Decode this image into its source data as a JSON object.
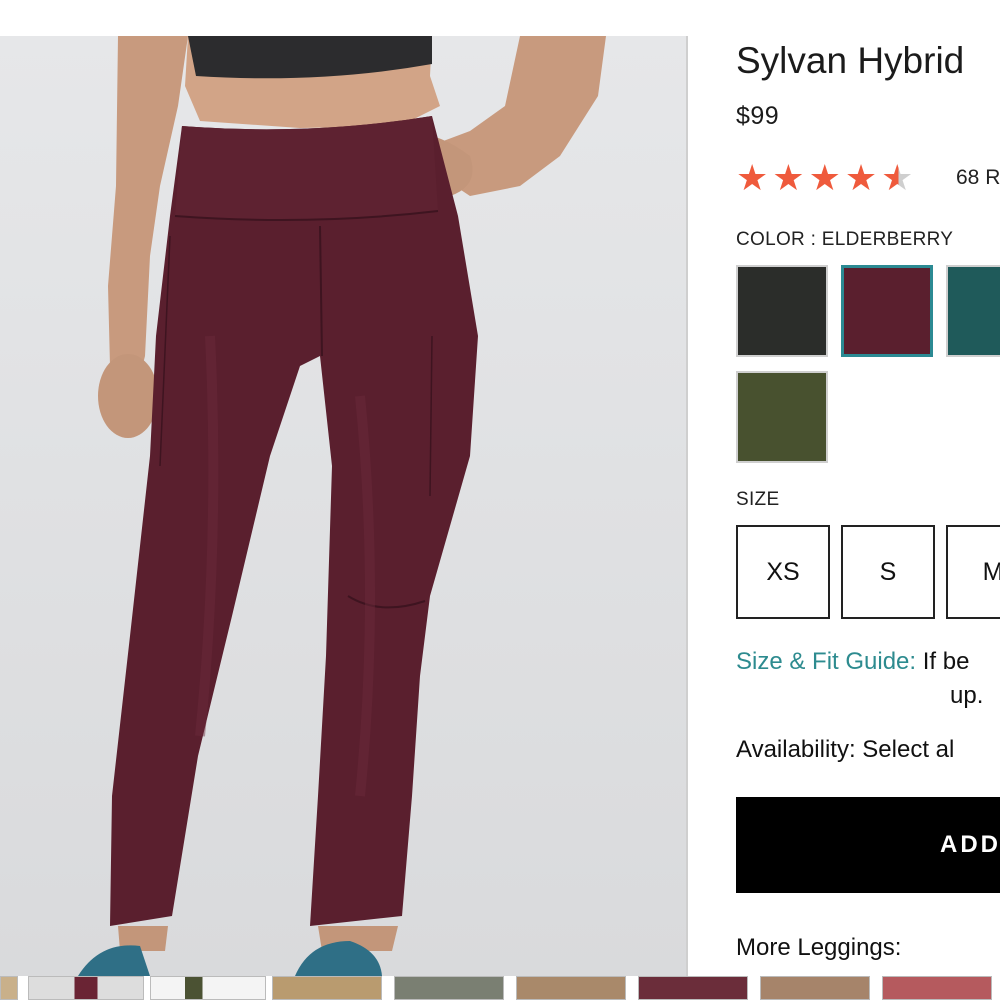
{
  "product": {
    "title": "Sylvan Hybrid",
    "price": "$99",
    "rating": {
      "value": 4.5,
      "max": 5,
      "count_label": "68 R"
    }
  },
  "color": {
    "label": "COLOR : ELDERBERRY",
    "swatches": [
      {
        "color": "#2b2d2a",
        "selected": false
      },
      {
        "color": "#5a1f2e",
        "selected": true
      },
      {
        "color": "#1f5a5a",
        "selected": false
      },
      {
        "color": "#48512f",
        "selected": false
      }
    ]
  },
  "size": {
    "label": "SIZE",
    "options": [
      "XS",
      "S",
      "M"
    ]
  },
  "fit_guide": {
    "link": "Size & Fit Guide:",
    "text": " If be",
    "continued": "up."
  },
  "availability": "Availability: Select al",
  "cart_button": "ADD",
  "more_section": "More Leggings:",
  "theme": {
    "accent": "#2d8b8f",
    "star": "#ef5a3c",
    "legging": "#5a1f2e"
  }
}
